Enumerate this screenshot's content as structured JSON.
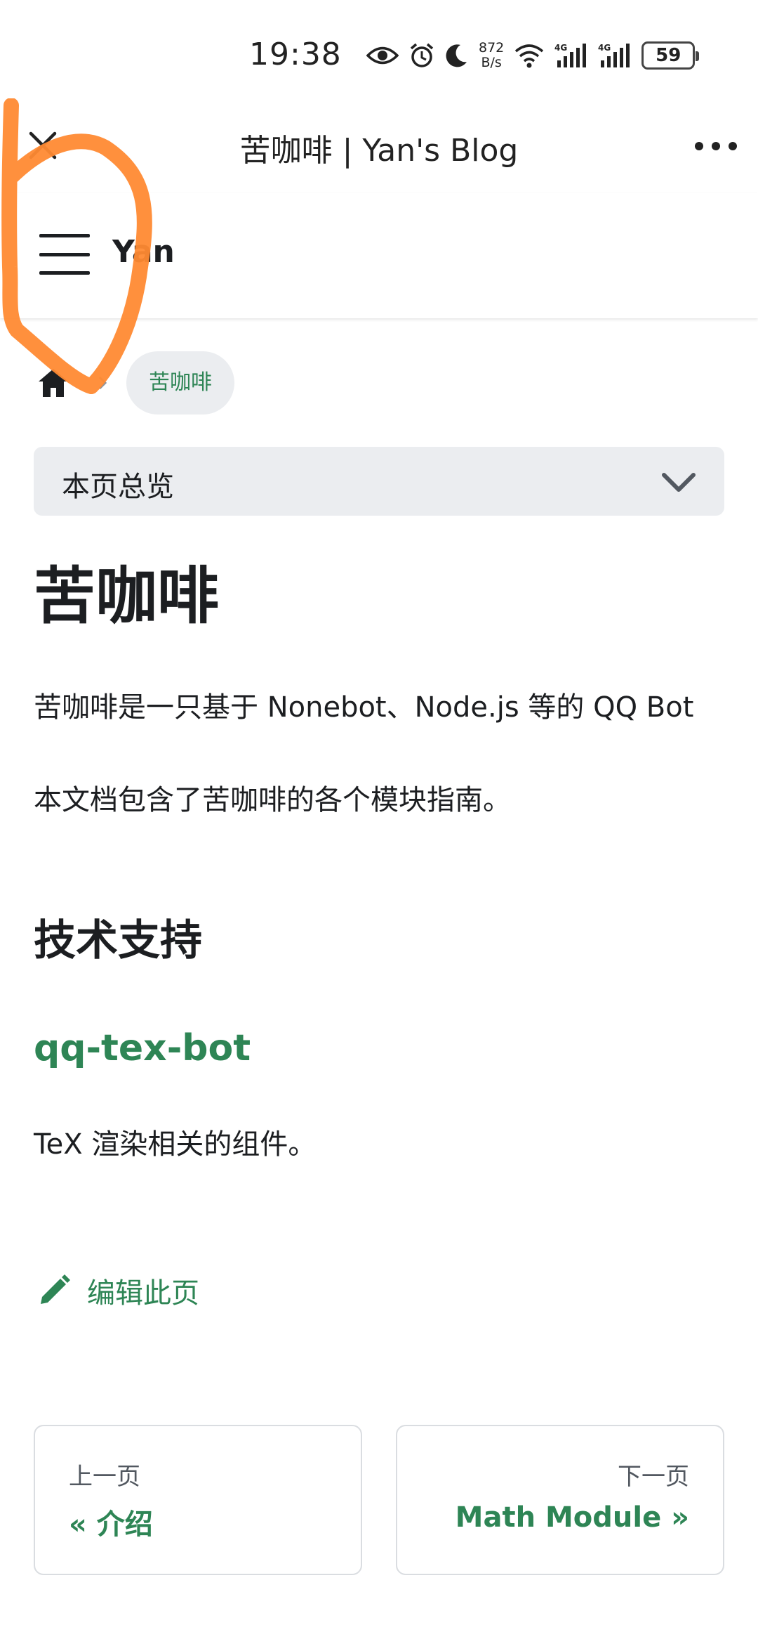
{
  "status_bar": {
    "time": "19:38",
    "net_speed_value": "872",
    "net_speed_unit": "B/s",
    "battery": "59",
    "icons": [
      "eye-icon",
      "alarm-icon",
      "moon-icon",
      "wifi-icon",
      "signal-4g-icon",
      "signal-4g-icon",
      "battery-icon"
    ]
  },
  "title_bar": {
    "title": "苦咖啡 | Yan's Blog"
  },
  "navbar": {
    "brand": "Yan"
  },
  "breadcrumb": {
    "current": "苦咖啡"
  },
  "toc": {
    "label": "本页总览"
  },
  "article": {
    "title": "苦咖啡",
    "paragraph1": "苦咖啡是一只基于 Nonebot、Node.js 等的 QQ Bot",
    "paragraph2": "本文档包含了苦咖啡的各个模块指南。",
    "section_heading": "技术支持",
    "subsection_heading": "qq-tex-bot",
    "paragraph3": "TeX 渲染相关的组件。"
  },
  "edit": {
    "label": "编辑此页"
  },
  "pagination": {
    "prev": {
      "sub": "上一页",
      "label": "« 介绍"
    },
    "next": {
      "sub": "下一页",
      "label": "Math Module »"
    }
  },
  "colors": {
    "accent": "#2e8555",
    "annotation": "#ff8a33",
    "muted_bg": "#ebedf0"
  }
}
